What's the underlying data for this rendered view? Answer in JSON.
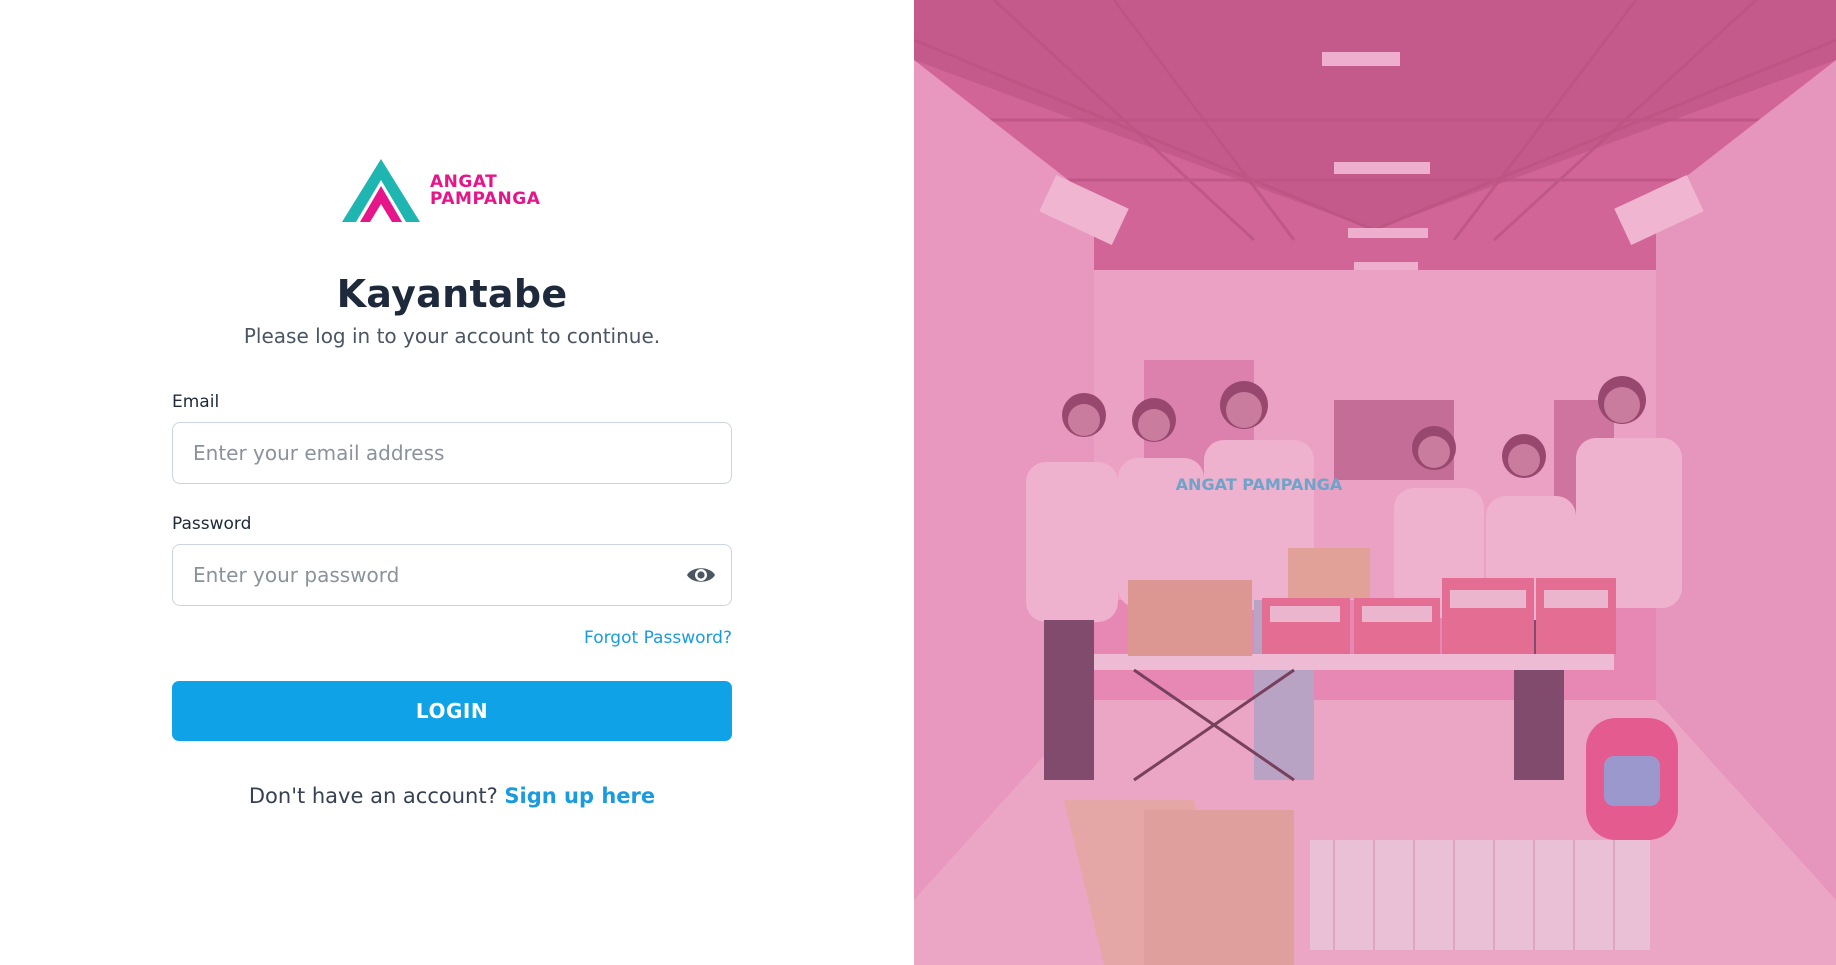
{
  "brand": {
    "logo_line1": "ANGAT",
    "logo_line2": "PAMPANGA",
    "accent_pink": "#e6168a",
    "accent_teal": "#1fb5b0"
  },
  "login": {
    "title": "Kayantabe",
    "subtitle": "Please log in to your account to continue.",
    "email_label": "Email",
    "email_placeholder": "Enter your email address",
    "password_label": "Password",
    "password_placeholder": "Enter your password",
    "forgot_label": "Forgot Password?",
    "submit_label": "LOGIN",
    "signup_prompt": "Don't have an account?",
    "signup_link": "Sign up here"
  },
  "photo_banner": {
    "shirt_text": "ANGAT PAMPANGA",
    "overlay_color": "#e779ad"
  },
  "colors": {
    "primary_button": "#10a2e6",
    "link": "#1a9be0"
  },
  "icons": {
    "password_toggle": "eye-icon"
  }
}
